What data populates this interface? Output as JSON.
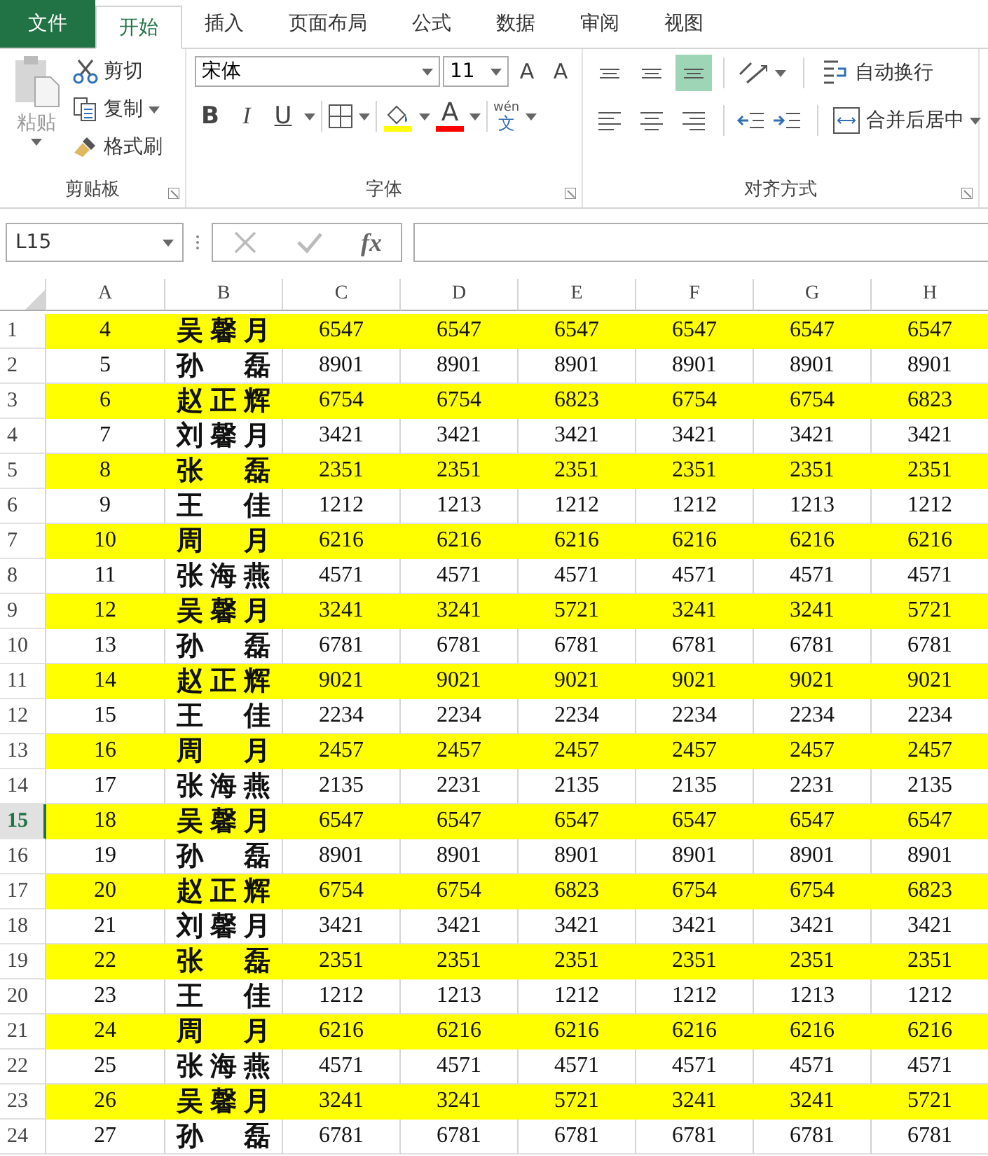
{
  "tabs": [
    {
      "label": "文件",
      "kind": "file",
      "selected": false
    },
    {
      "label": "开始",
      "kind": "tab",
      "selected": true
    },
    {
      "label": "插入",
      "kind": "tab",
      "selected": false
    },
    {
      "label": "页面布局",
      "kind": "tab",
      "selected": false
    },
    {
      "label": "公式",
      "kind": "tab",
      "selected": false
    },
    {
      "label": "数据",
      "kind": "tab",
      "selected": false
    },
    {
      "label": "审阅",
      "kind": "tab",
      "selected": false
    },
    {
      "label": "视图",
      "kind": "tab",
      "selected": false
    }
  ],
  "ribbon": {
    "clipboard": {
      "title": "剪贴板",
      "paste": "粘贴",
      "cut": "剪切",
      "copy": "复制",
      "format_painter": "格式刷"
    },
    "font": {
      "title": "字体",
      "font_name": "宋体",
      "font_size": "11",
      "grow": "A",
      "shrink": "A",
      "bold": "B",
      "italic": "I",
      "underline": "U",
      "font_color": "A",
      "phonetic_top": "wén",
      "phonetic_bottom": "文"
    },
    "alignment": {
      "title": "对齐方式",
      "align_buttons": [
        {
          "kind": "top",
          "selected": false
        },
        {
          "kind": "middle",
          "selected": false
        },
        {
          "kind": "bottom",
          "selected": true
        },
        {
          "kind": "left",
          "selected": false
        },
        {
          "kind": "center",
          "selected": false
        },
        {
          "kind": "right",
          "selected": false
        }
      ],
      "wrap_text": "自动换行",
      "merge_center": "合并后居中"
    }
  },
  "formula_bar": {
    "name_box": "L15",
    "fx": "fx"
  },
  "sheet": {
    "columns": [
      "A",
      "B",
      "C",
      "D",
      "E",
      "F",
      "G",
      "H"
    ],
    "rows": [
      {
        "number": "1",
        "selected": false,
        "highlighted": true,
        "cells": [
          "4",
          "吴馨月",
          "6547",
          "6547",
          "6547",
          "6547",
          "6547",
          "6547"
        ]
      },
      {
        "number": "2",
        "selected": false,
        "highlighted": false,
        "cells": [
          "5",
          "孙磊",
          "8901",
          "8901",
          "8901",
          "8901",
          "8901",
          "8901"
        ]
      },
      {
        "number": "3",
        "selected": false,
        "highlighted": true,
        "cells": [
          "6",
          "赵正辉",
          "6754",
          "6754",
          "6823",
          "6754",
          "6754",
          "6823"
        ]
      },
      {
        "number": "4",
        "selected": false,
        "highlighted": false,
        "cells": [
          "7",
          "刘馨月",
          "3421",
          "3421",
          "3421",
          "3421",
          "3421",
          "3421"
        ]
      },
      {
        "number": "5",
        "selected": false,
        "highlighted": true,
        "cells": [
          "8",
          "张磊",
          "2351",
          "2351",
          "2351",
          "2351",
          "2351",
          "2351"
        ]
      },
      {
        "number": "6",
        "selected": false,
        "highlighted": false,
        "cells": [
          "9",
          "王佳",
          "1212",
          "1213",
          "1212",
          "1212",
          "1213",
          "1212"
        ]
      },
      {
        "number": "7",
        "selected": false,
        "highlighted": true,
        "cells": [
          "10",
          "周月",
          "6216",
          "6216",
          "6216",
          "6216",
          "6216",
          "6216"
        ]
      },
      {
        "number": "8",
        "selected": false,
        "highlighted": false,
        "cells": [
          "11",
          "张海燕",
          "4571",
          "4571",
          "4571",
          "4571",
          "4571",
          "4571"
        ]
      },
      {
        "number": "9",
        "selected": false,
        "highlighted": true,
        "cells": [
          "12",
          "吴馨月",
          "3241",
          "3241",
          "5721",
          "3241",
          "3241",
          "5721"
        ]
      },
      {
        "number": "10",
        "selected": false,
        "highlighted": false,
        "cells": [
          "13",
          "孙磊",
          "6781",
          "6781",
          "6781",
          "6781",
          "6781",
          "6781"
        ]
      },
      {
        "number": "11",
        "selected": false,
        "highlighted": true,
        "cells": [
          "14",
          "赵正辉",
          "9021",
          "9021",
          "9021",
          "9021",
          "9021",
          "9021"
        ]
      },
      {
        "number": "12",
        "selected": false,
        "highlighted": false,
        "cells": [
          "15",
          "王佳",
          "2234",
          "2234",
          "2234",
          "2234",
          "2234",
          "2234"
        ]
      },
      {
        "number": "13",
        "selected": false,
        "highlighted": true,
        "cells": [
          "16",
          "周月",
          "2457",
          "2457",
          "2457",
          "2457",
          "2457",
          "2457"
        ]
      },
      {
        "number": "14",
        "selected": false,
        "highlighted": false,
        "cells": [
          "17",
          "张海燕",
          "2135",
          "2231",
          "2135",
          "2135",
          "2231",
          "2135"
        ]
      },
      {
        "number": "15",
        "selected": true,
        "highlighted": true,
        "cells": [
          "18",
          "吴馨月",
          "6547",
          "6547",
          "6547",
          "6547",
          "6547",
          "6547"
        ]
      },
      {
        "number": "16",
        "selected": false,
        "highlighted": false,
        "cells": [
          "19",
          "孙磊",
          "8901",
          "8901",
          "8901",
          "8901",
          "8901",
          "8901"
        ]
      },
      {
        "number": "17",
        "selected": false,
        "highlighted": true,
        "cells": [
          "20",
          "赵正辉",
          "6754",
          "6754",
          "6823",
          "6754",
          "6754",
          "6823"
        ]
      },
      {
        "number": "18",
        "selected": false,
        "highlighted": false,
        "cells": [
          "21",
          "刘馨月",
          "3421",
          "3421",
          "3421",
          "3421",
          "3421",
          "3421"
        ]
      },
      {
        "number": "19",
        "selected": false,
        "highlighted": true,
        "cells": [
          "22",
          "张磊",
          "2351",
          "2351",
          "2351",
          "2351",
          "2351",
          "2351"
        ]
      },
      {
        "number": "20",
        "selected": false,
        "highlighted": false,
        "cells": [
          "23",
          "王佳",
          "1212",
          "1213",
          "1212",
          "1212",
          "1213",
          "1212"
        ]
      },
      {
        "number": "21",
        "selected": false,
        "highlighted": true,
        "cells": [
          "24",
          "周月",
          "6216",
          "6216",
          "6216",
          "6216",
          "6216",
          "6216"
        ]
      },
      {
        "number": "22",
        "selected": false,
        "highlighted": false,
        "cells": [
          "25",
          "张海燕",
          "4571",
          "4571",
          "4571",
          "4571",
          "4571",
          "4571"
        ]
      },
      {
        "number": "23",
        "selected": false,
        "highlighted": true,
        "cells": [
          "26",
          "吴馨月",
          "3241",
          "3241",
          "5721",
          "3241",
          "3241",
          "5721"
        ]
      },
      {
        "number": "24",
        "selected": false,
        "highlighted": false,
        "cells": [
          "27",
          "孙磊",
          "6781",
          "6781",
          "6781",
          "6781",
          "6781",
          "6781"
        ]
      }
    ]
  }
}
